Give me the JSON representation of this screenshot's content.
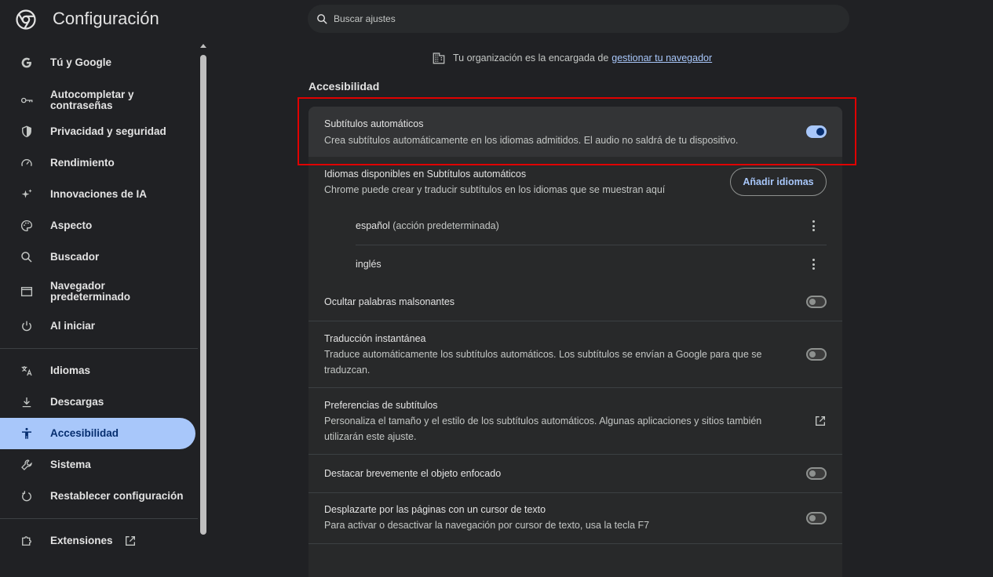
{
  "header": {
    "title": "Configuración",
    "search_placeholder": "Buscar ajustes"
  },
  "sidebar": {
    "items": [
      {
        "label": "Tú y Google",
        "icon": "google-icon"
      },
      {
        "label": "Autocompletar y contraseñas",
        "icon": "key-icon"
      },
      {
        "label": "Privacidad y seguridad",
        "icon": "shield-icon"
      },
      {
        "label": "Rendimiento",
        "icon": "speedometer-icon"
      },
      {
        "label": "Innovaciones de IA",
        "icon": "sparkle-icon"
      },
      {
        "label": "Aspecto",
        "icon": "palette-icon"
      },
      {
        "label": "Buscador",
        "icon": "search-icon"
      },
      {
        "label": "Navegador predeterminado",
        "icon": "browser-window-icon"
      },
      {
        "label": "Al iniciar",
        "icon": "power-icon"
      },
      {
        "label": "Idiomas",
        "icon": "translate-icon"
      },
      {
        "label": "Descargas",
        "icon": "download-icon"
      },
      {
        "label": "Accesibilidad",
        "icon": "accessibility-icon",
        "active": true
      },
      {
        "label": "Sistema",
        "icon": "wrench-icon"
      },
      {
        "label": "Restablecer configuración",
        "icon": "reset-icon"
      },
      {
        "label": "Extensiones",
        "icon": "puzzle-icon"
      }
    ]
  },
  "banner": {
    "text": "Tu organización es la encargada de",
    "link": "gestionar tu navegador",
    "icon": "building-icon"
  },
  "section": {
    "title": "Accesibilidad"
  },
  "settings": {
    "live_caption": {
      "title": "Subtítulos automáticos",
      "desc": "Crea subtítulos automáticamente en los idiomas admitidos. El audio no saldrá de tu dispositivo.",
      "enabled": true
    },
    "languages": {
      "title": "Idiomas disponibles en Subtítulos automáticos",
      "desc": "Chrome puede crear y traducir subtítulos en los idiomas que se muestran aquí",
      "add_button": "Añadir idiomas",
      "items": [
        {
          "name": "español",
          "tag": "(acción predeterminada)"
        },
        {
          "name": "inglés",
          "tag": ""
        }
      ]
    },
    "profanity": {
      "title": "Ocultar palabras malsonantes",
      "enabled": false
    },
    "translate": {
      "title": "Traducción instantánea",
      "desc_line1": "Traduce automáticamente los subtítulos automáticos. Los subtítulos se envían a Google para que se",
      "desc_line2": "traduzcan.",
      "enabled": false
    },
    "caption_prefs": {
      "title": "Preferencias de subtítulos",
      "desc_line1": "Personaliza el tamaño y el estilo de los subtítulos automáticos. Algunas aplicaciones y sitios también",
      "desc_line2": "utilizarán este ajuste."
    },
    "focus_highlight": {
      "title": "Destacar brevemente el objeto enfocado",
      "enabled": false
    },
    "caret_browsing": {
      "title": "Desplazarte por las páginas con un cursor de texto",
      "desc": "Para activar o desactivar la navegación por cursor de texto, usa la tecla F7",
      "enabled": false
    }
  },
  "colors": {
    "background": "#202124",
    "card": "#28292a",
    "accent": "#a8c7fa",
    "highlight_border": "#e00000"
  }
}
